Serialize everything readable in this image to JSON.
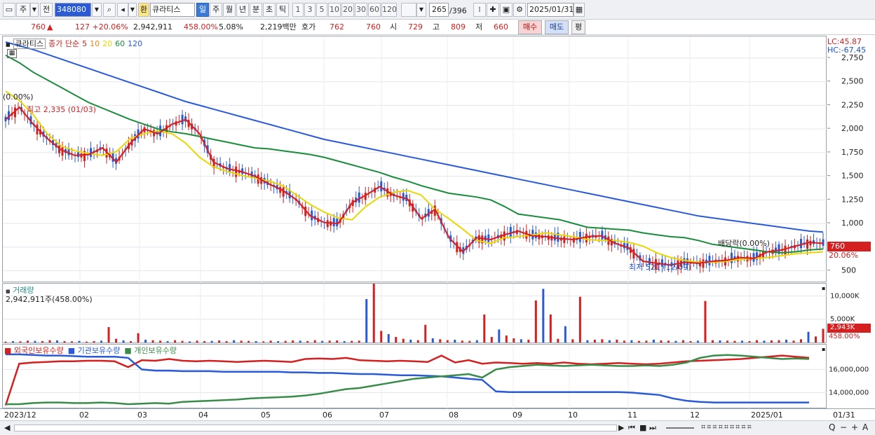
{
  "toolbar": {
    "market": "주",
    "prev": "전",
    "code": "348080",
    "currency_badge": "환",
    "name": "큐라티스",
    "periods": [
      "일",
      "주",
      "월",
      "년",
      "분",
      "초",
      "틱"
    ],
    "active_period": "일",
    "intervals": [
      "1",
      "3",
      "5",
      "10",
      "20",
      "30",
      "60",
      "120"
    ],
    "count": "265",
    "total": "/396",
    "date": "2025/01/31"
  },
  "quote": {
    "price": "760",
    "change": "127 +20.06%",
    "volume": "2,942,911",
    "vol_pct": "458.00%",
    "turnover": "5.08%",
    "amount": "2,219백만",
    "hoga_label": "호가",
    "ask": "762",
    "bid": "760",
    "open_label": "시",
    "open": "729",
    "high_label": "고",
    "high": "809",
    "low_label": "저",
    "low": "660",
    "buy": "매수",
    "sell": "매도",
    "eval": "평"
  },
  "price_panel": {
    "title": "큐라티스",
    "ma_label": "종가 단순",
    "ma_periods": [
      "5",
      "10",
      "20",
      "60",
      "120"
    ],
    "ma_colors": [
      "#d42020",
      "#e98a18",
      "#e8d800",
      "#1a8c3a",
      "#2a5ad8"
    ],
    "ref_label": "(0.00%)",
    "max_label": "최고 2,335 (01/03)",
    "min_label": "최저 521 (12/09)",
    "div_label": "배당락(0.00%)",
    "lc": "LC:45.87",
    "hc": "HC:-67.45",
    "price_tag": "760",
    "pct_tag": "20.06%"
  },
  "volume_panel": {
    "title": "거래량",
    "value": "2,942,911주(458.00%)",
    "tag_value": "2,943K",
    "tag_pct": "458.00%"
  },
  "holder_panel": {
    "legend": [
      "외국인보유수량",
      "기관보유수량",
      "개인보유수량"
    ],
    "colors": [
      "#d42020",
      "#2a5ad8",
      "#3a8c4a"
    ]
  },
  "x_axis_labels": [
    "2023/12",
    "02",
    "03",
    "04",
    "05",
    "06",
    "07",
    "08",
    "09",
    "10",
    "11",
    "12",
    "2025/01",
    "01/31"
  ],
  "chart_data": [
    {
      "type": "line",
      "title": "큐라티스",
      "y_ticks": [
        500,
        750,
        1000,
        1250,
        1500,
        1750,
        2000,
        2250,
        2500,
        2750
      ],
      "y_tick_labels": [
        "500",
        "750",
        "1,000",
        "1,250",
        "1,500",
        "1,750",
        "2,000",
        "2,250",
        "2,500",
        "2,750"
      ],
      "ylim": [
        400,
        2950
      ],
      "series": [
        {
          "name": "120",
          "color": "#2a5ad8",
          "values": [
            2920,
            2880,
            2840,
            2790,
            2740,
            2690,
            2640,
            2590,
            2540,
            2490,
            2440,
            2390,
            2340,
            2290,
            2250,
            2210,
            2170,
            2130,
            2090,
            2050,
            2010,
            1970,
            1930,
            1890,
            1860,
            1830,
            1800,
            1770,
            1740,
            1710,
            1680,
            1650,
            1620,
            1590,
            1560,
            1530,
            1500,
            1470,
            1440,
            1410,
            1380,
            1350,
            1320,
            1290,
            1260,
            1230,
            1200,
            1170,
            1140,
            1110,
            1080,
            1060,
            1040,
            1020,
            1000,
            980,
            960,
            940,
            920,
            910
          ]
        },
        {
          "name": "60",
          "color": "#1a8c3a",
          "values": [
            2780,
            2700,
            2600,
            2520,
            2440,
            2360,
            2280,
            2220,
            2160,
            2100,
            2050,
            2000,
            1970,
            1950,
            1920,
            1890,
            1860,
            1830,
            1800,
            1790,
            1770,
            1750,
            1730,
            1700,
            1660,
            1620,
            1580,
            1540,
            1490,
            1450,
            1400,
            1360,
            1320,
            1300,
            1280,
            1250,
            1180,
            1100,
            1080,
            1060,
            1040,
            1000,
            960,
            950,
            940,
            930,
            900,
            880,
            860,
            850,
            820,
            780,
            760,
            740,
            720,
            700,
            690,
            700,
            720,
            730
          ]
        },
        {
          "name": "20",
          "color": "#e8d800",
          "values": [
            2400,
            2300,
            2150,
            1950,
            1820,
            1770,
            1740,
            1720,
            1760,
            1900,
            1950,
            1980,
            1950,
            1850,
            1700,
            1600,
            1550,
            1510,
            1480,
            1450,
            1400,
            1300,
            1200,
            1120,
            1060,
            1040,
            1180,
            1280,
            1330,
            1350,
            1300,
            1150,
            1050,
            940,
            820,
            790,
            850,
            860,
            880,
            900,
            880,
            860,
            830,
            820,
            820,
            800,
            760,
            690,
            640,
            610,
            590,
            590,
            600,
            620,
            630,
            640,
            660,
            680,
            690,
            700
          ]
        },
        {
          "name": "5",
          "color": "#d42020",
          "values": [
            2100,
            2230,
            2050,
            1900,
            1780,
            1720,
            1730,
            1800,
            1650,
            1850,
            2000,
            1950,
            2050,
            2100,
            1950,
            1650,
            1580,
            1550,
            1500,
            1420,
            1350,
            1250,
            1080,
            1010,
            1000,
            1220,
            1300,
            1390,
            1300,
            1260,
            1050,
            1150,
            850,
            700,
            850,
            830,
            880,
            920,
            870,
            860,
            840,
            830,
            860,
            870,
            790,
            740,
            600,
            580,
            560,
            590,
            580,
            600,
            610,
            640,
            630,
            700,
            720,
            760,
            800,
            790
          ]
        }
      ]
    },
    {
      "type": "bar",
      "title": "거래량",
      "y_ticks": [
        5000,
        10000
      ],
      "y_tick_labels": [
        "5,000K",
        "10,000K"
      ],
      "ylim": [
        0,
        12000
      ],
      "values": [
        200,
        300,
        250,
        400,
        350,
        300,
        500,
        450,
        300,
        250,
        350,
        200,
        300,
        400,
        3300,
        800,
        450,
        300,
        2000,
        600,
        500,
        400,
        300,
        500,
        350,
        250,
        400,
        300,
        350,
        450,
        300,
        500,
        400,
        350,
        300,
        250,
        400,
        300,
        350,
        450,
        400,
        300,
        500,
        350,
        400,
        450,
        300,
        350,
        400,
        9300,
        13000,
        2500,
        1800,
        1200,
        800,
        600,
        500,
        3800,
        900,
        700,
        500,
        600,
        400,
        350,
        500,
        6000,
        1200,
        2800,
        1500,
        900,
        700,
        600,
        9000,
        11500,
        6000,
        800,
        3500,
        700,
        9800,
        500,
        600,
        700,
        500,
        600,
        400,
        500,
        350,
        400,
        600,
        450,
        400,
        350,
        500,
        300,
        400,
        8900,
        500,
        450,
        400,
        350,
        400,
        300,
        500,
        400,
        450,
        500,
        600,
        400,
        700,
        2300,
        1300,
        2940
      ]
    },
    {
      "type": "line",
      "title": "외국인보유수량 · 기관보유수량 · 개인보유수량",
      "y_ticks": [
        14000000,
        16000000
      ],
      "y_tick_labels": [
        "14,000,000",
        "16,000,000"
      ],
      "ylim": [
        12700000,
        17900000
      ],
      "series": [
        {
          "name": "외국인보유수량",
          "color": "#d42020",
          "values": [
            12900000,
            16500000,
            16600000,
            16650000,
            16700000,
            16700000,
            16750000,
            16750000,
            16700000,
            16200000,
            16800000,
            16750000,
            16900000,
            16750000,
            16700000,
            16750000,
            16700000,
            16650000,
            16700000,
            16750000,
            16700000,
            16650000,
            16900000,
            16950000,
            16900000,
            17000000,
            16800000,
            16750000,
            16700000,
            16750000,
            16700000,
            16650000,
            17200000,
            16600000,
            16800000,
            16500000,
            16600000,
            16550000,
            16500000,
            16550000,
            16500000,
            16600000,
            16500000,
            16450000,
            16500000,
            16550000,
            16500000,
            16450000,
            16500000,
            16600000,
            16700000,
            16750000,
            16800000,
            16850000,
            16900000,
            17000000,
            17100000,
            17200000,
            17100000,
            17000000
          ]
        },
        {
          "name": "기관보유수량",
          "color": "#2a5ad8",
          "values": [
            17300000,
            17300000,
            17250000,
            17200000,
            17200000,
            17150000,
            17100000,
            17100000,
            17100000,
            17000000,
            16000000,
            15900000,
            15900000,
            15850000,
            15850000,
            15850000,
            15800000,
            15800000,
            15800000,
            15800000,
            15800000,
            15750000,
            15750000,
            15700000,
            15700000,
            15650000,
            15600000,
            15600000,
            15550000,
            15500000,
            15500000,
            15450000,
            15400000,
            15300000,
            15200000,
            15100000,
            14100000,
            14050000,
            14050000,
            14050000,
            14050000,
            14050000,
            14050000,
            14050000,
            14050000,
            14050000,
            14000000,
            13900000,
            13800000,
            13500000,
            13300000,
            13200000,
            13150000,
            13150000,
            13150000,
            13150000,
            13150000,
            13150000,
            13150000,
            13150000
          ]
        },
        {
          "name": "개인보유수량",
          "color": "#3a8c4a",
          "values": [
            13000000,
            13000000,
            13100000,
            13150000,
            13150000,
            13100000,
            13100000,
            13150000,
            13100000,
            13000000,
            13050000,
            13100000,
            13050000,
            13200000,
            13250000,
            13300000,
            13350000,
            13400000,
            13500000,
            13550000,
            13600000,
            13650000,
            13750000,
            13900000,
            14100000,
            14300000,
            14400000,
            14600000,
            14800000,
            15000000,
            15200000,
            15300000,
            15400000,
            15500000,
            15600000,
            15300000,
            16000000,
            16200000,
            16300000,
            16400000,
            16350000,
            16300000,
            16350000,
            16400000,
            16350000,
            16300000,
            16300000,
            16350000,
            16300000,
            16400000,
            16600000,
            17000000,
            17200000,
            17250000,
            17200000,
            17100000,
            17000000,
            16900000,
            16950000,
            16900000
          ]
        }
      ]
    }
  ]
}
